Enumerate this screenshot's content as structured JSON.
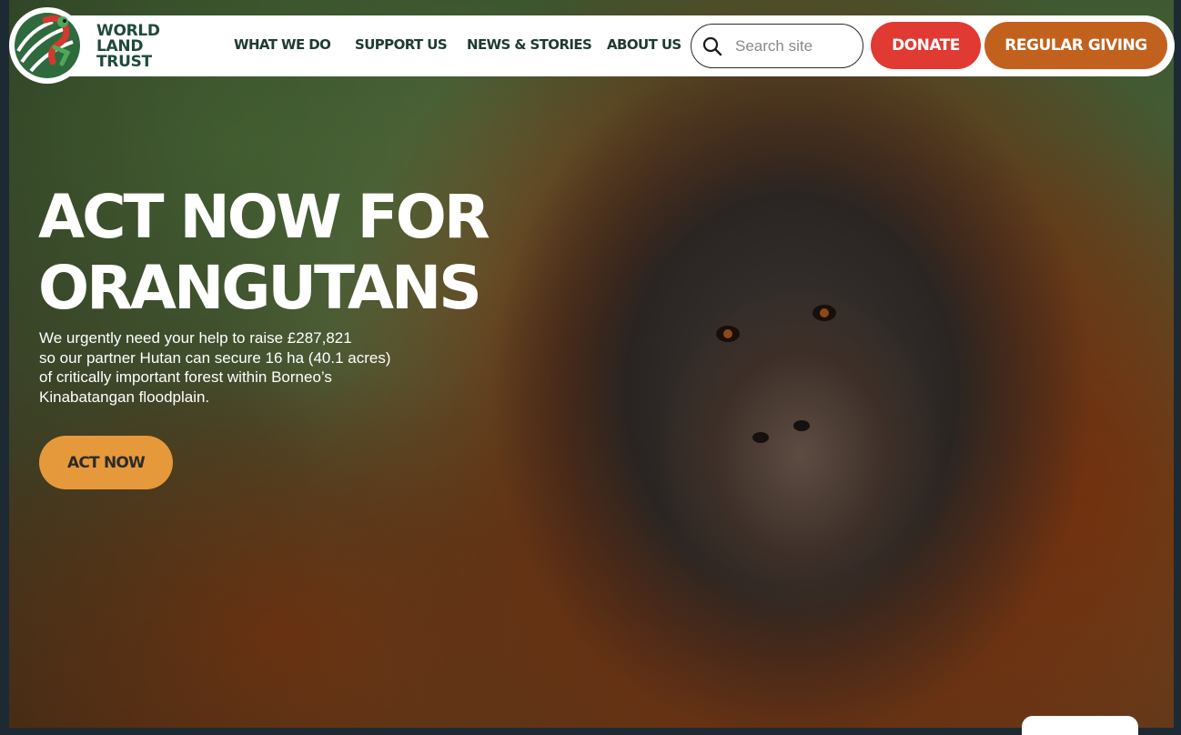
{
  "logo": {
    "lines": [
      "WORLD",
      "LAND",
      "TRUST"
    ]
  },
  "nav": {
    "items": [
      {
        "label": "WHAT WE DO"
      },
      {
        "label": "SUPPORT US"
      },
      {
        "label": "NEWS & STORIES"
      },
      {
        "label": "ABOUT US"
      }
    ]
  },
  "search": {
    "placeholder": "Search site",
    "value": ""
  },
  "buttons": {
    "donate": "DONATE",
    "regular_giving": "REGULAR GIVING"
  },
  "hero": {
    "title_lines": [
      "ACT NOW FOR",
      "ORANGUTANS"
    ],
    "description_lines": [
      "We urgently need your help to raise £287,821",
      "so our partner Hutan can secure 16 ha (40.1 acres)",
      "of critically important forest within Borneo’s",
      "Kinabatangan floodplain."
    ],
    "cta": "ACT NOW"
  },
  "colors": {
    "donate": "#e03a32",
    "regular_giving": "#c2611e",
    "cta": "#e6993a",
    "brand_green": "#1f4a3a"
  },
  "icons": {
    "search": "search-icon",
    "logo": "frog-logo-icon"
  }
}
